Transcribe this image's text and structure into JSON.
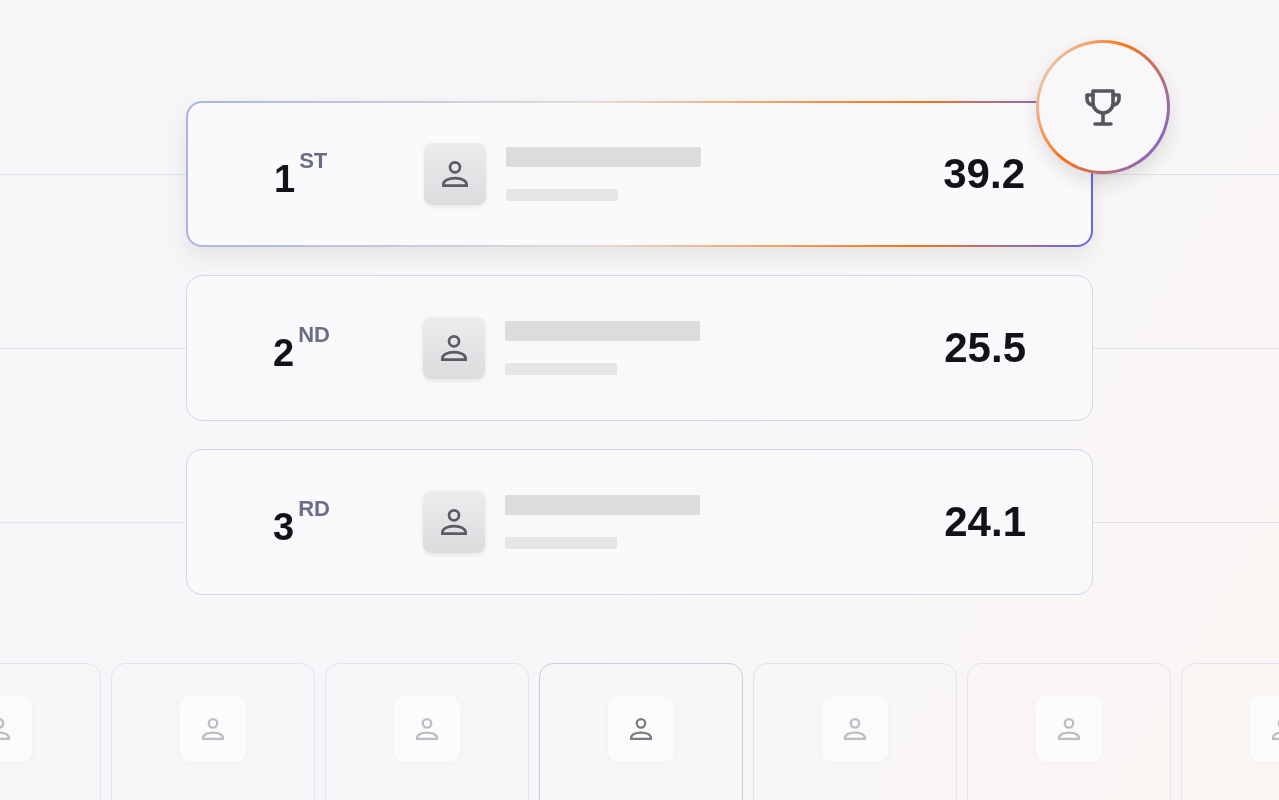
{
  "leaderboard": [
    {
      "rank": "1",
      "suffix": "ST",
      "score": "39.2",
      "selected": true
    },
    {
      "rank": "2",
      "suffix": "ND",
      "score": "25.5",
      "selected": false
    },
    {
      "rank": "3",
      "suffix": "RD",
      "score": "24.1",
      "selected": false
    }
  ],
  "tiles": [
    {
      "selected": false
    },
    {
      "selected": false
    },
    {
      "selected": false
    },
    {
      "selected": true
    },
    {
      "selected": false
    },
    {
      "selected": false
    },
    {
      "selected": false
    }
  ]
}
